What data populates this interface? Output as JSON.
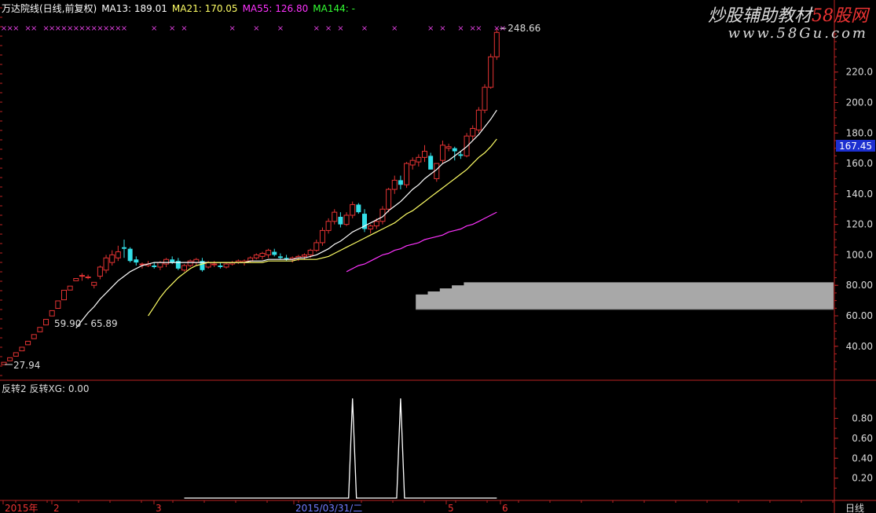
{
  "header": {
    "title": "万达院线(日线,前复权)",
    "ma13": "MA13: 189.01",
    "ma21": "MA21: 170.05",
    "ma55": "MA55: 126.80",
    "ma144": "MA144: -",
    "colors": {
      "ma13": "#ffffff",
      "ma21": "#ffff66",
      "ma55": "#ff33ff",
      "ma144": "#33ff33"
    }
  },
  "watermark": {
    "line1_a": "炒股辅助教材",
    "line1_b": "58股网",
    "line2": "www.58Gu.com"
  },
  "sub_header": "反转2 反转XG: 0.00",
  "period_label": "日线",
  "price_tag": "167.45",
  "annotations": {
    "high": "248.66",
    "low": "27.94",
    "range": "59.90 - 65.89"
  },
  "chart_data": [
    {
      "type": "candlestick",
      "title": "万达院线(日线,前复权)",
      "ylim": [
        20,
        250
      ],
      "y_ticks": [
        "40.00",
        "60.00",
        "80.00",
        "100.0",
        "120.0",
        "140.0",
        "160.0",
        "180.0",
        "200.0",
        "220.0"
      ],
      "x_ticks": [
        "2015年",
        "2",
        "3",
        "2015/03/31/二",
        "5",
        "6"
      ],
      "grid": false,
      "candles": [
        [
          27.94,
          29.5,
          27.94,
          29.5
        ],
        [
          30.5,
          32.5,
          30.5,
          32.5
        ],
        [
          33.5,
          35.8,
          33.5,
          35.8
        ],
        [
          37,
          39.4,
          37,
          39.4
        ],
        [
          41,
          43.3,
          41,
          43.3
        ],
        [
          45,
          47.7,
          45,
          47.7
        ],
        [
          49.5,
          52.4,
          49.5,
          52.4
        ],
        [
          54,
          57.7,
          54,
          57.7
        ],
        [
          59.9,
          63.4,
          59.9,
          63.4
        ],
        [
          64.9,
          69.8,
          64.9,
          69.8
        ],
        [
          70.5,
          76.8,
          70.5,
          76.8
        ],
        [
          76.9,
          79.5,
          76.9,
          79.5
        ],
        [
          83,
          84.5,
          83,
          84.5
        ],
        [
          86,
          88,
          83,
          86.5
        ],
        [
          85,
          87,
          84,
          85.5
        ],
        [
          80,
          82,
          78,
          82
        ],
        [
          86,
          93,
          84,
          92
        ],
        [
          90,
          100,
          88,
          98
        ],
        [
          95,
          103,
          93,
          100
        ],
        [
          98,
          106,
          96,
          102
        ],
        [
          105,
          110,
          98,
          104
        ],
        [
          104,
          105,
          95,
          96
        ],
        [
          97,
          99,
          93,
          95
        ],
        [
          94,
          95,
          91,
          94
        ],
        [
          93,
          96,
          92,
          94
        ],
        [
          93,
          95,
          91,
          92
        ],
        [
          92,
          96,
          90,
          95
        ],
        [
          94,
          98,
          92,
          97
        ],
        [
          97,
          99,
          94,
          95
        ],
        [
          96,
          98,
          90,
          91
        ],
        [
          90,
          94,
          89,
          93
        ],
        [
          93,
          97,
          92,
          96
        ],
        [
          95,
          98,
          93,
          97
        ],
        [
          96,
          98,
          89,
          90
        ],
        [
          92,
          96,
          91,
          95
        ],
        [
          94,
          96,
          92,
          94
        ],
        [
          93,
          95,
          91,
          92
        ],
        [
          92,
          95,
          91,
          94
        ],
        [
          94,
          96,
          93,
          95
        ],
        [
          95,
          97,
          94,
          96
        ],
        [
          95,
          97,
          93,
          96
        ],
        [
          96,
          99,
          95,
          98
        ],
        [
          98,
          101,
          97,
          100
        ],
        [
          99,
          102,
          97,
          101
        ],
        [
          100,
          104,
          98,
          103
        ],
        [
          102,
          104,
          99,
          100
        ],
        [
          99,
          101,
          97,
          98
        ],
        [
          98,
          100,
          96,
          97
        ],
        [
          97,
          99,
          95,
          98
        ],
        [
          98,
          100,
          96,
          99
        ],
        [
          99,
          101,
          97,
          100
        ],
        [
          100,
          104,
          98,
          103
        ],
        [
          103,
          110,
          102,
          108
        ],
        [
          108,
          118,
          106,
          116
        ],
        [
          116,
          124,
          114,
          122
        ],
        [
          122,
          130,
          120,
          128
        ],
        [
          125,
          128,
          118,
          120
        ],
        [
          120,
          128,
          119,
          126
        ],
        [
          126,
          135,
          124,
          133
        ],
        [
          133,
          134,
          127,
          128
        ],
        [
          127,
          130,
          115,
          117
        ],
        [
          117,
          120,
          114,
          119
        ],
        [
          119,
          124,
          117,
          122
        ],
        [
          122,
          132,
          120,
          130
        ],
        [
          130,
          144,
          128,
          143
        ],
        [
          143,
          152,
          140,
          149
        ],
        [
          149,
          152,
          143,
          146
        ],
        [
          146,
          161,
          144,
          160
        ],
        [
          159,
          164,
          156,
          162
        ],
        [
          161,
          166,
          158,
          164
        ],
        [
          164,
          172,
          161,
          168
        ],
        [
          165,
          167,
          156,
          156
        ],
        [
          150,
          160,
          148,
          160
        ],
        [
          162,
          175,
          160,
          172
        ],
        [
          170,
          173,
          168,
          171
        ],
        [
          170,
          171,
          162,
          168
        ],
        [
          166,
          168,
          163,
          165
        ],
        [
          165,
          180,
          164,
          178
        ],
        [
          178,
          185,
          175,
          183
        ],
        [
          182,
          197,
          180,
          195
        ],
        [
          195,
          212,
          193,
          210
        ],
        [
          210,
          232,
          209,
          230
        ],
        [
          230,
          248.66,
          228,
          246
        ]
      ],
      "ma13": [
        null,
        null,
        null,
        null,
        null,
        null,
        null,
        null,
        null,
        null,
        null,
        null,
        52,
        57,
        62,
        66,
        71,
        75,
        79,
        83,
        86,
        89,
        91,
        93,
        94,
        95,
        95,
        95,
        95,
        95,
        95,
        95,
        95,
        95,
        95,
        95,
        95,
        95,
        95,
        95,
        95,
        96,
        96,
        96,
        97,
        97,
        97,
        97,
        97,
        98,
        98,
        99,
        100,
        102,
        104,
        107,
        109,
        112,
        115,
        117,
        119,
        121,
        123,
        125,
        129,
        132,
        135,
        139,
        143,
        146,
        150,
        153,
        156,
        160,
        162,
        165,
        168,
        171,
        175,
        179,
        184,
        189,
        195
      ],
      "ma21": [
        null,
        null,
        null,
        null,
        null,
        null,
        null,
        null,
        null,
        null,
        null,
        null,
        null,
        null,
        null,
        null,
        null,
        null,
        null,
        null,
        null,
        null,
        null,
        null,
        60,
        66,
        72,
        77,
        81,
        85,
        88,
        91,
        93,
        94,
        95,
        95,
        95,
        95,
        95,
        95,
        95,
        95,
        95,
        95,
        96,
        96,
        96,
        96,
        96,
        97,
        97,
        97,
        97,
        98,
        99,
        101,
        103,
        105,
        107,
        109,
        111,
        113,
        115,
        117,
        119,
        121,
        124,
        127,
        129,
        132,
        135,
        138,
        141,
        144,
        147,
        150,
        153,
        156,
        160,
        164,
        167,
        171,
        176
      ],
      "ma55": [
        null,
        null,
        null,
        null,
        null,
        null,
        null,
        null,
        null,
        null,
        null,
        null,
        null,
        null,
        null,
        null,
        null,
        null,
        null,
        null,
        null,
        null,
        null,
        null,
        null,
        null,
        null,
        null,
        null,
        null,
        null,
        null,
        null,
        null,
        null,
        null,
        null,
        null,
        null,
        null,
        null,
        null,
        null,
        null,
        null,
        null,
        null,
        null,
        null,
        null,
        null,
        null,
        null,
        null,
        null,
        null,
        null,
        89,
        91,
        93,
        94,
        96,
        98,
        100,
        101,
        103,
        104,
        106,
        107,
        108,
        110,
        111,
        112,
        113,
        115,
        116,
        117,
        119,
        120,
        122,
        124,
        126,
        128
      ],
      "markers_x": [
        0,
        1,
        2,
        4,
        5,
        7,
        8,
        9,
        10,
        11,
        12,
        13,
        14,
        15,
        16,
        17,
        18,
        19,
        20,
        25,
        28,
        30,
        38,
        42,
        46,
        52,
        54,
        56,
        60,
        65,
        71,
        73,
        76,
        78,
        79,
        82,
        83
      ],
      "markers_tail": [
        82,
        83
      ],
      "rects": [
        [
          82,
          78,
          76
        ],
        [
          80,
          75,
          74
        ],
        [
          78,
          71,
          72
        ],
        [
          76,
          68,
          70
        ],
        [
          74,
          64,
          68
        ]
      ]
    },
    {
      "type": "line",
      "title": "反转2 反转XG: 0.00",
      "ylim": [
        0,
        1.1
      ],
      "y_ticks": [
        "0.20",
        "0.40",
        "0.60",
        "0.80"
      ],
      "start_index": 30,
      "spikes": [
        58,
        66
      ],
      "value": 0.0
    }
  ]
}
